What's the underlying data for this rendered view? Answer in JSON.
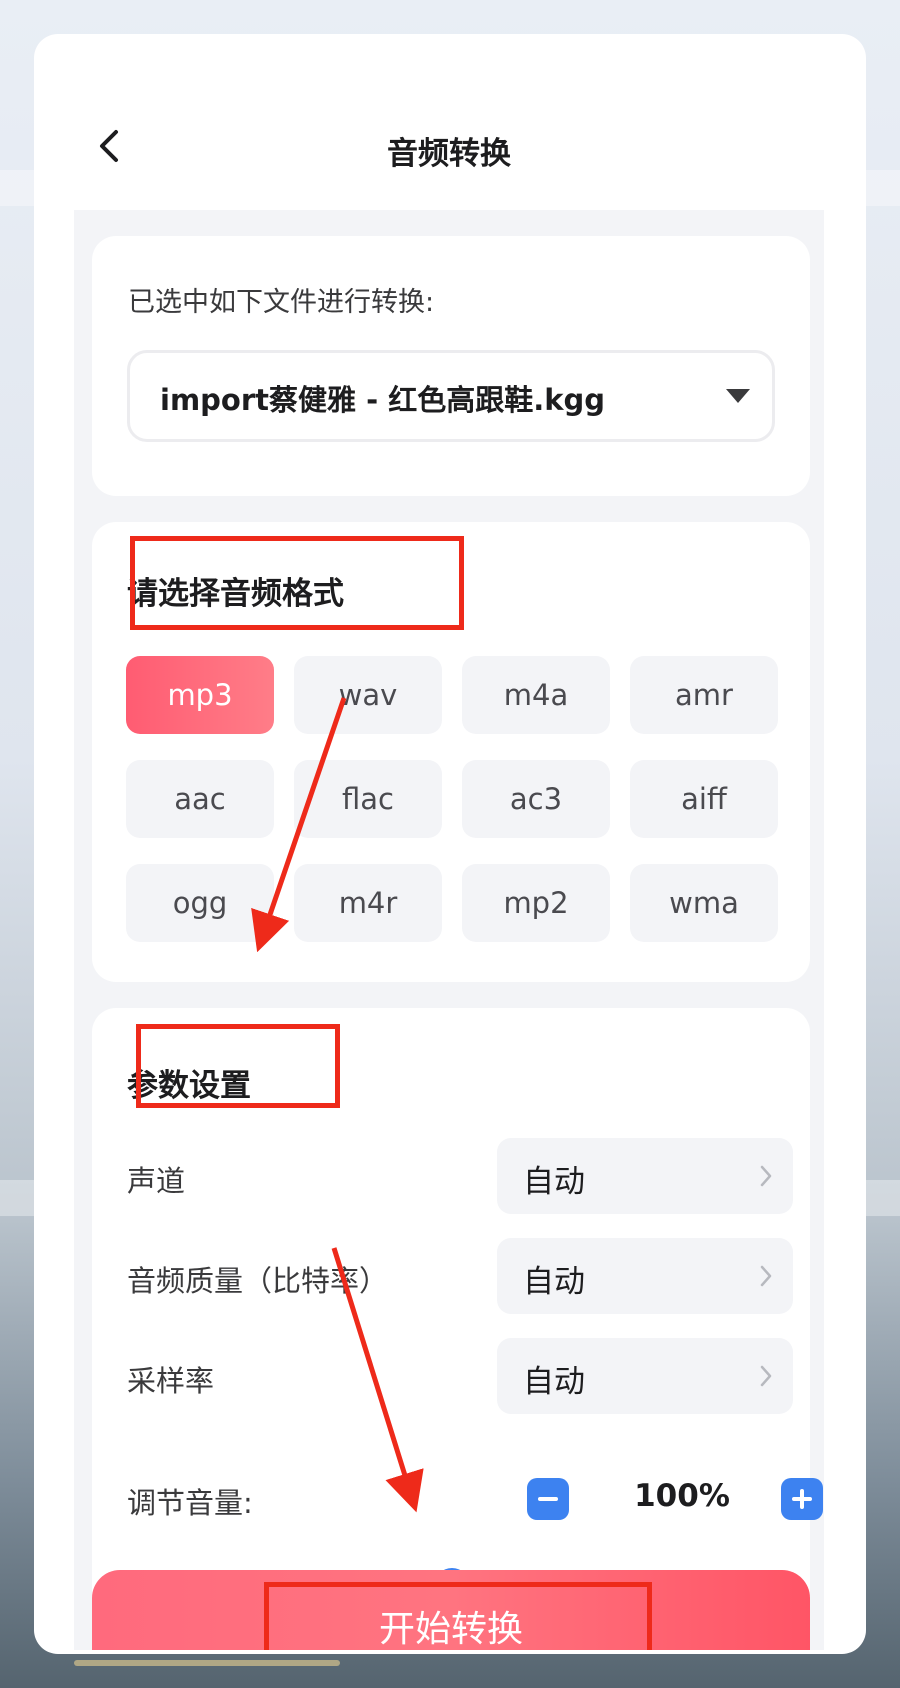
{
  "header": {
    "title": "音频转换",
    "back_icon": "chevron-left-icon"
  },
  "file": {
    "label": "已选中如下文件进行转换:",
    "selected": "import蔡健雅 - 红色高跟鞋.kgg",
    "dropdown_icon": "caret-down-icon"
  },
  "format": {
    "title": "请选择音频格式",
    "options": [
      "mp3",
      "wav",
      "m4a",
      "amr",
      "aac",
      "flac",
      "ac3",
      "aiff",
      "ogg",
      "m4r",
      "mp2",
      "wma"
    ],
    "selected": "mp3"
  },
  "params": {
    "title": "参数设置",
    "rows": [
      {
        "label": "声道",
        "value": "自动"
      },
      {
        "label": "音频质量（比特率）",
        "value": "自动"
      },
      {
        "label": "采样率",
        "value": "自动"
      }
    ],
    "volume": {
      "label": "调节音量:",
      "value": "100%",
      "level": 0.5
    }
  },
  "action": {
    "start_label": "开始转换"
  },
  "colors": {
    "accent": "#ff5c72",
    "blue": "#3d82f0",
    "annotation": "#ee2a1a"
  }
}
